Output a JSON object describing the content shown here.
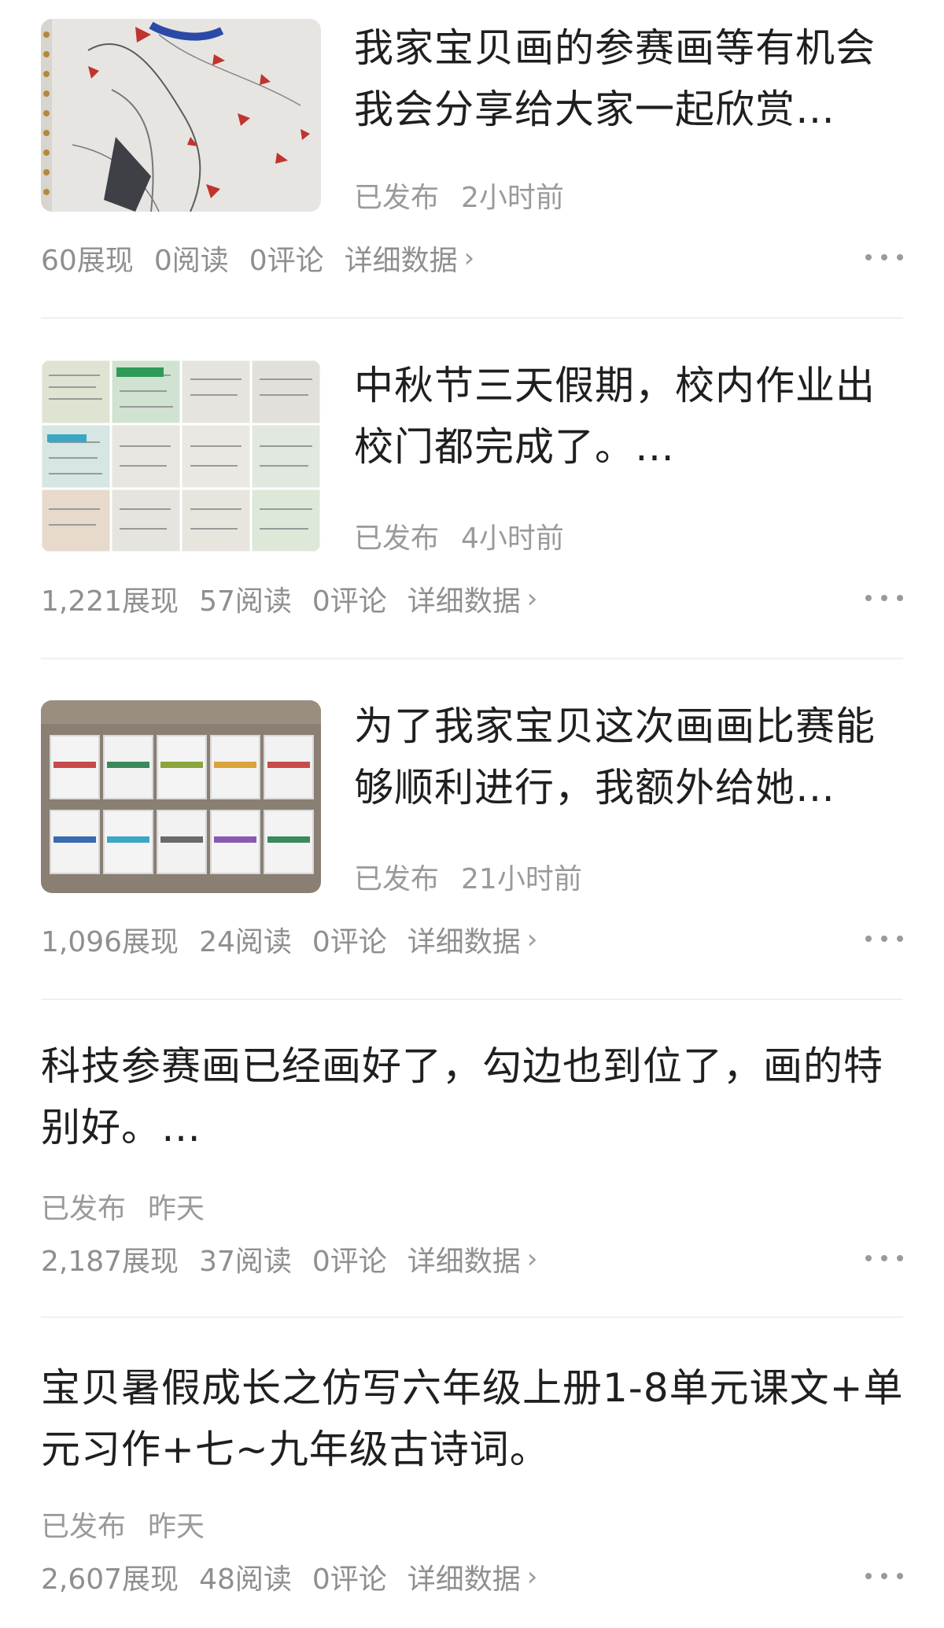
{
  "posts": [
    {
      "title": "我家宝贝画的参赛画等有机会我会分享给大家一起欣赏…",
      "status": "已发布",
      "time": "2小时前",
      "impressions": "60展现",
      "reads": "0阅读",
      "comments": "0评论",
      "detail": "详细数据",
      "thumbnail_icon": "artwork-photo"
    },
    {
      "title": "中秋节三天假期，校内作业出校门都完成了。…",
      "status": "已发布",
      "time": "4小时前",
      "impressions": "1,221展现",
      "reads": "57阅读",
      "comments": "0评论",
      "detail": "详细数据",
      "thumbnail_icon": "homework-collage"
    },
    {
      "title": "为了我家宝贝这次画画比赛能够顺利进行，我额外给她…",
      "status": "已发布",
      "time": "21小时前",
      "impressions": "1,096展现",
      "reads": "24阅读",
      "comments": "0评论",
      "detail": "详细数据",
      "thumbnail_icon": "marker-boxes-photo"
    },
    {
      "title": "科技参赛画已经画好了，勾边也到位了，画的特别好。…",
      "status": "已发布",
      "time": "昨天",
      "impressions": "2,187展现",
      "reads": "37阅读",
      "comments": "0评论",
      "detail": "详细数据"
    },
    {
      "title": "宝贝暑假成长之仿写六年级上册1-8单元课文+单元习作+七~九年级古诗词。",
      "status": "已发布",
      "time": "昨天",
      "impressions": "2,607展现",
      "reads": "48阅读",
      "comments": "0评论",
      "detail": "详细数据"
    }
  ],
  "colors": {
    "title": "#1f1f1f",
    "meta": "#9a9a9a",
    "divider": "#f0f0f0"
  }
}
